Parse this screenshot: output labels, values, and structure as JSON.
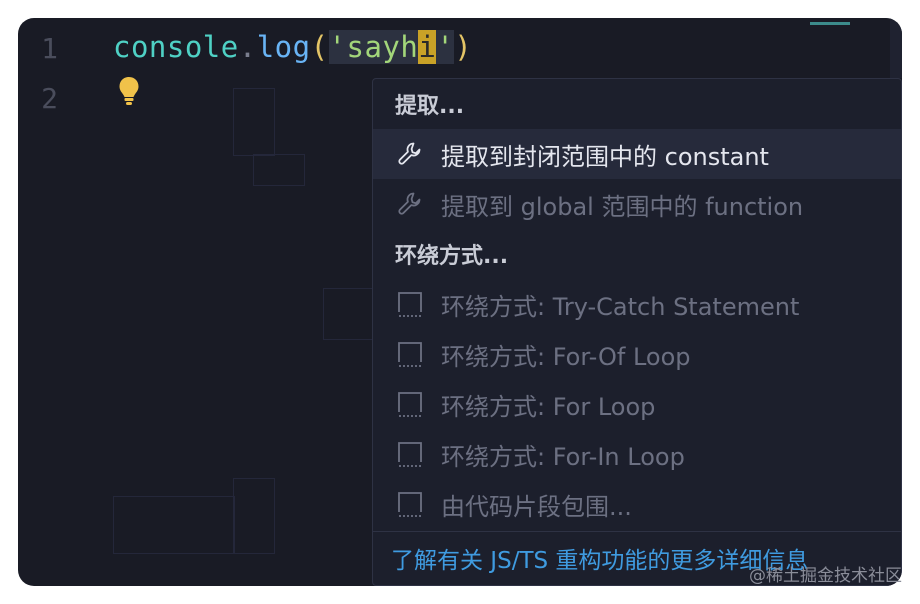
{
  "editor": {
    "lines": [
      {
        "number": "1"
      },
      {
        "number": "2"
      }
    ],
    "code": {
      "object": "console",
      "dot": ".",
      "method": "log",
      "open_paren": "(",
      "string_before_cursor": "'sayh",
      "string_cursor_char": "i",
      "string_after_cursor": "'",
      "close_paren": ")"
    },
    "lightbulb_icon": "lightbulb-icon"
  },
  "menu": {
    "header_extract": "提取...",
    "item_extract_constant": "提取到封闭范围中的 constant",
    "item_extract_function": "提取到 global 范围中的 function",
    "header_surround": "环绕方式...",
    "item_try_catch": "环绕方式: Try-Catch Statement",
    "item_for_of": "环绕方式: For-Of Loop",
    "item_for": "环绕方式: For Loop",
    "item_for_in": "环绕方式: For-In Loop",
    "item_snippet": "由代码片段包围...",
    "learn_more": "了解有关 JS/TS 重构功能的更多详细信息",
    "icons": {
      "refactor": "wrench-icon",
      "surround": "snippet-box-icon"
    }
  },
  "watermark": "@稀土掘金技术社区",
  "colors": {
    "editor_bg": "#191b25",
    "menu_bg": "#1c1f2c",
    "selected_bg": "#262a3b",
    "link": "#3f9be0",
    "cursor": "#c9a227"
  }
}
